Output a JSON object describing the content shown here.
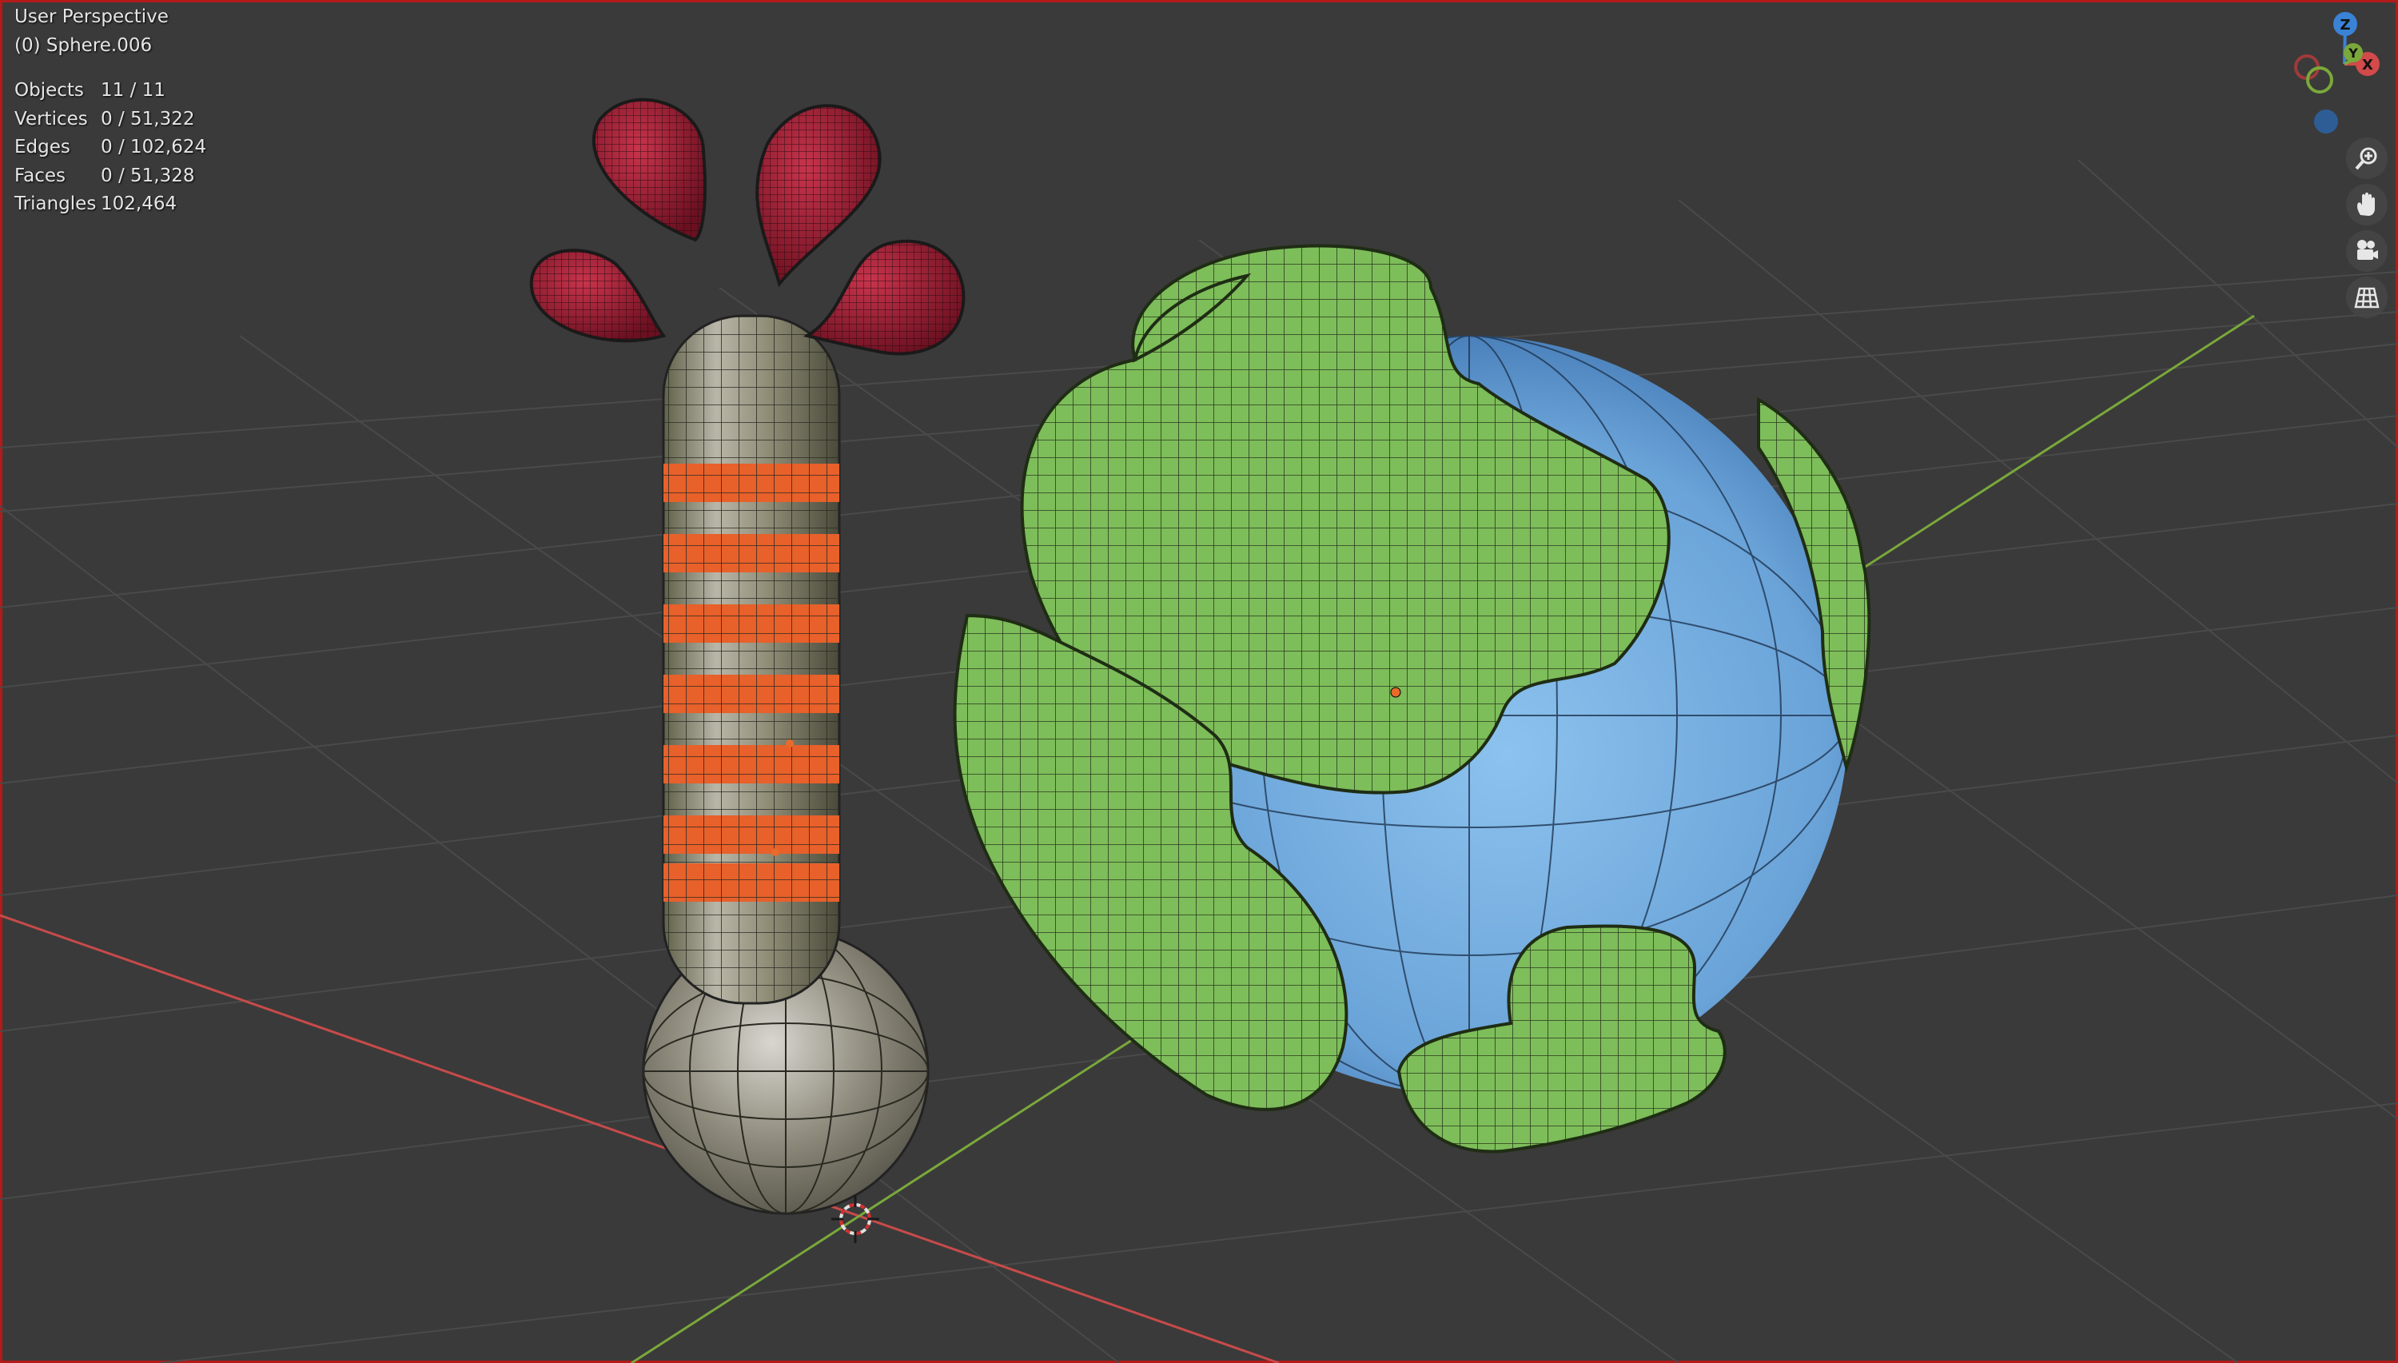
{
  "viewport": {
    "view_name": "User Perspective",
    "active_object": "(0) Sphere.006"
  },
  "stats": [
    {
      "label": "Objects",
      "value": "11 / 11"
    },
    {
      "label": "Vertices",
      "value": "0 / 51,322"
    },
    {
      "label": "Edges",
      "value": "0 / 102,624"
    },
    {
      "label": "Faces",
      "value": "0 / 51,328"
    },
    {
      "label": "Triangles",
      "value": "102,464"
    }
  ],
  "gizmo": {
    "z": "Z",
    "y": "Y",
    "x": "X"
  },
  "nav_tools": [
    {
      "name": "zoom-icon"
    },
    {
      "name": "hand-pan-icon"
    },
    {
      "name": "camera-icon"
    },
    {
      "name": "grid-icon"
    }
  ],
  "colors": {
    "background": "#3a3a3a",
    "x_axis": "#c84a4a",
    "y_axis": "#7aa83a",
    "z_axis": "#3a82d6",
    "land": "#7dbd5a",
    "ocean": "#6aa3d8",
    "drops": "#a5253a",
    "stripes": "#e8602a",
    "frame": "#b31a1a"
  }
}
